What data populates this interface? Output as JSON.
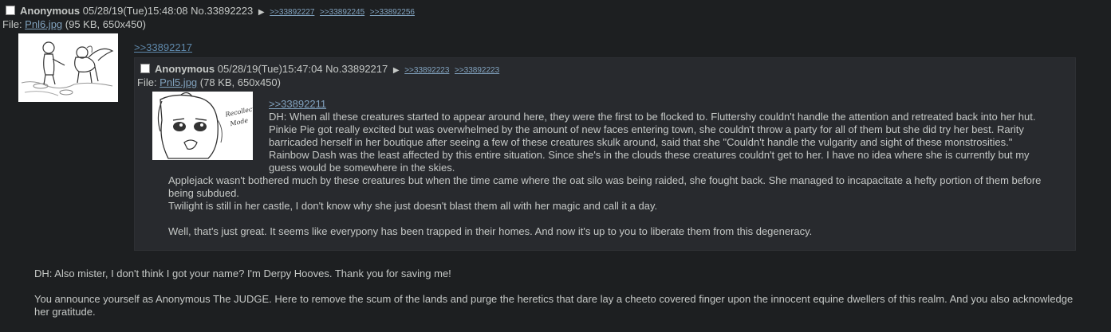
{
  "post": {
    "name": "Anonymous",
    "datetime": "05/28/19(Tue)15:48:08",
    "number": "No.33892223",
    "backlinks": [
      ">>33892227",
      ">>33892245",
      ">>33892256"
    ],
    "file_prefix": "File: ",
    "file_name": "Pnl6.jpg",
    "file_meta": "(95 KB, 650x450)",
    "quote_link": ">>33892217",
    "body_lines": [
      "DH: Also mister, I don't think I got your name? I'm Derpy Hooves. Thank you for saving me!",
      "",
      "You announce yourself as Anonymous The JUDGE. Here to remove the scum of the lands and purge the heretics that dare lay a cheeto covered finger upon the innocent equine dwellers of this realm. And you also acknowledge her gratitude."
    ]
  },
  "quoted_post": {
    "name": "Anonymous",
    "datetime": "05/28/19(Tue)15:47:04",
    "number": "No.33892217",
    "backlinks": [
      ">>33892223",
      ">>33892223"
    ],
    "file_prefix": "File: ",
    "file_name": "Pnl5.jpg",
    "file_meta": "(78 KB, 650x450)",
    "quote_link": ">>33892211",
    "thumb_caption": "Recollection Mode",
    "body_lines": [
      "DH: When all these creatures started to appear around here, they were the first to be flocked to. Fluttershy couldn't handle the attention and retreated back into her hut.",
      "Pinkie Pie got really excited but was overwhelmed by the amount of new faces entering town, she couldn't throw a party for all of them but she did try her best. Rarity barricaded herself in her boutique after seeing a few of these creatures skulk around, said that she \"Couldn't handle the vulgarity and sight of these monstrosities.\"",
      "Rainbow Dash was the least affected by this entire situation. Since she's in the clouds these creatures couldn't get to her. I have no idea where she is currently but my guess would be somewhere in the skies.",
      "Applejack wasn't bothered much by these creatures but when the time came where the oat silo was being raided, she fought back. She managed to incapacitate a hefty portion of them before being subdued.",
      "Twilight is still in her castle, I don't know why she just doesn't blast them all with her magic and call it a day.",
      "",
      "Well, that's just great. It seems like everypony has been trapped in their homes. And now it's up to you to liberate them from this degeneracy."
    ]
  }
}
